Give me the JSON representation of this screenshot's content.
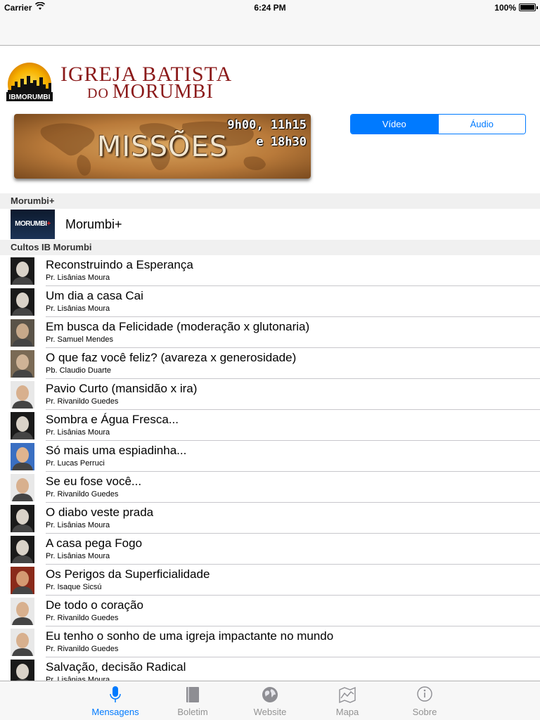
{
  "status_bar": {
    "carrier": "Carrier",
    "time": "6:24 PM",
    "battery": "100%"
  },
  "header": {
    "church_name_line1": "IGREJA BATISTA",
    "church_name_line2_small": "DO",
    "church_name_line2_big": "MORUMBI",
    "logo_text": "IBMORUMBI"
  },
  "missions_banner": {
    "title": "MISSÕES",
    "time_line1": "9h00, 11h15",
    "time_line2": "e 18h30"
  },
  "segmented_control": {
    "options": [
      "Vídeo",
      "Áudio"
    ],
    "selected": "Vídeo"
  },
  "sections": [
    {
      "header": "Morumbi+",
      "thumb_text": "MORUMBI",
      "thumb_plus": "+",
      "item": "Morumbi+"
    },
    {
      "header": "Cultos IB Morumbi"
    }
  ],
  "sermons": [
    {
      "title": "Reconstruindo a Esperança",
      "preacher": "Pr. Lisânias Moura"
    },
    {
      "title": "Um dia a casa Cai",
      "preacher": "Pr. Lisânias Moura"
    },
    {
      "title": "Em busca da Felicidade (moderação x glutonaria)",
      "preacher": "Pr. Samuel Mendes"
    },
    {
      "title": "O que faz você feliz? (avareza x generosidade)",
      "preacher": "Pb. Claudio Duarte"
    },
    {
      "title": "Pavio Curto (mansidão x ira)",
      "preacher": "Pr. Rivanildo Guedes"
    },
    {
      "title": "Sombra e Água Fresca...",
      "preacher": "Pr. Lisânias Moura"
    },
    {
      "title": "Só mais uma espiadinha...",
      "preacher": "Pr. Lucas Perruci"
    },
    {
      "title": "Se eu fose você...",
      "preacher": "Pr. Rivanildo Guedes"
    },
    {
      "title": "O diabo veste prada",
      "preacher": "Pr. Lisânias Moura"
    },
    {
      "title": "A casa pega Fogo",
      "preacher": "Pr. Lisânias Moura"
    },
    {
      "title": "Os Perigos da Superficialidade",
      "preacher": "Pr. Isaque Sicsú"
    },
    {
      "title": "De todo o coração",
      "preacher": "Pr. Rivanildo Guedes"
    },
    {
      "title": "Eu tenho o sonho de uma igreja impactante no mundo",
      "preacher": "Pr. Rivanildo Guedes"
    },
    {
      "title": "Salvação, decisão Radical",
      "preacher": "Pr. Lisânias Moura"
    }
  ],
  "tab_bar": {
    "tabs": [
      {
        "label": "Mensagens",
        "icon": "microphone-icon"
      },
      {
        "label": "Boletim",
        "icon": "book-icon"
      },
      {
        "label": "Website",
        "icon": "globe-icon"
      },
      {
        "label": "Mapa",
        "icon": "map-icon"
      },
      {
        "label": "Sobre",
        "icon": "info-icon"
      }
    ],
    "selected": "Mensagens"
  },
  "colors": {
    "accent": "#007aff",
    "church_red": "#8b1a1a",
    "inactive_tab": "#929292"
  }
}
